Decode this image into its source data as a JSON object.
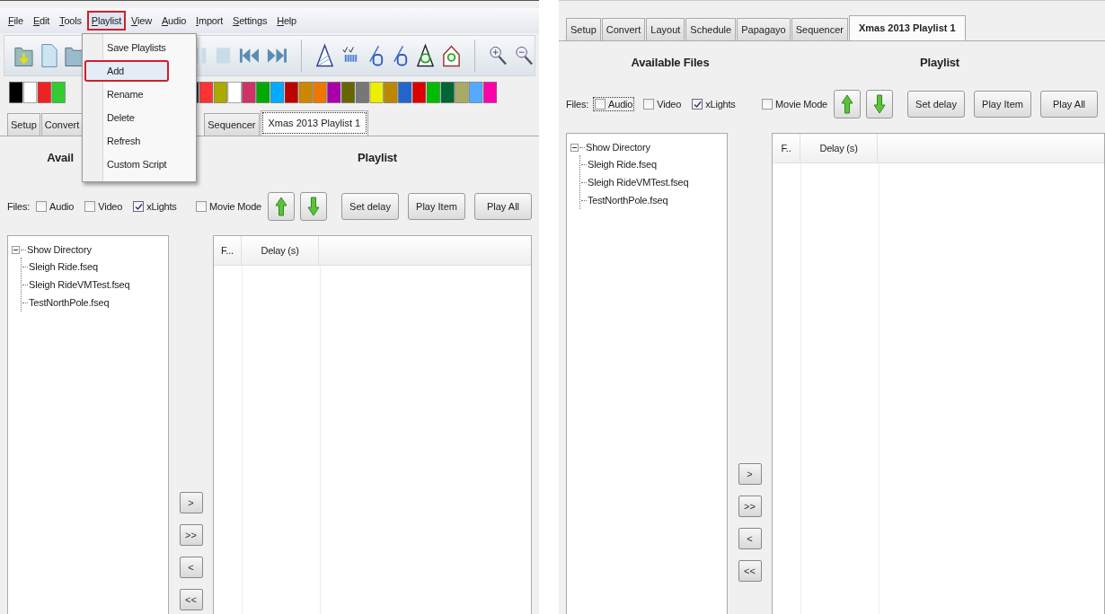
{
  "left": {
    "menu_bar": [
      {
        "label": "File",
        "open": false,
        "annotated": false
      },
      {
        "label": "Edit",
        "open": false,
        "annotated": false
      },
      {
        "label": "Tools",
        "open": false,
        "annotated": false
      },
      {
        "label": "Playlist",
        "open": true,
        "annotated": true
      },
      {
        "label": "View",
        "open": false,
        "annotated": false
      },
      {
        "label": "Audio",
        "open": false,
        "annotated": false
      },
      {
        "label": "Import",
        "open": false,
        "annotated": false
      },
      {
        "label": "Settings",
        "open": false,
        "annotated": false
      },
      {
        "label": "Help",
        "open": false,
        "annotated": false
      }
    ],
    "playlist_menu": [
      {
        "label": "Save Playlists",
        "highlighted": false,
        "annotated": false
      },
      {
        "label": "Add",
        "highlighted": true,
        "annotated": true
      },
      {
        "label": "Rename",
        "highlighted": false,
        "annotated": false
      },
      {
        "label": "Delete",
        "highlighted": false,
        "annotated": false
      },
      {
        "label": "Refresh",
        "highlighted": false,
        "annotated": false
      },
      {
        "label": "Custom Script",
        "highlighted": false,
        "annotated": false
      }
    ],
    "tabs": [
      {
        "label": "Setup",
        "selected": false,
        "focused": false
      },
      {
        "label": "Convert",
        "selected": false,
        "focused": false
      },
      {
        "label": "Sequencer",
        "selected": false,
        "focused": false
      },
      {
        "label": "Xmas 2013 Playlist 1",
        "selected": true,
        "focused": true
      }
    ],
    "available_files_title": "Avail",
    "playlist_title": "Playlist",
    "files_label": "Files:",
    "file_filters": [
      {
        "label": "Audio",
        "checked": false,
        "focused": false
      },
      {
        "label": "Video",
        "checked": false,
        "focused": false
      },
      {
        "label": "xLights",
        "checked": true,
        "focused": false
      }
    ],
    "movie_mode": {
      "label": "Movie Mode",
      "checked": false
    },
    "buttons": [
      "Set delay",
      "Play Item",
      "Play All"
    ],
    "tree": {
      "label": "Show Directory",
      "expanded": true,
      "children": [
        {
          "label": "Sleigh Ride.fseq"
        },
        {
          "label": "Sleigh RideVMTest.fseq"
        },
        {
          "label": "TestNorthPole.fseq"
        }
      ]
    },
    "table": {
      "columns": [
        "F...",
        "Delay (s)"
      ]
    },
    "transfer_buttons": [
      ">",
      ">>",
      "<",
      "<<"
    ]
  },
  "right": {
    "tabs": [
      {
        "label": "Setup",
        "selected": false,
        "focused": false
      },
      {
        "label": "Convert",
        "selected": false,
        "focused": false
      },
      {
        "label": "Layout",
        "selected": false,
        "focused": false
      },
      {
        "label": "Schedule",
        "selected": false,
        "focused": false
      },
      {
        "label": "Papagayo",
        "selected": false,
        "focused": false
      },
      {
        "label": "Sequencer",
        "selected": false,
        "focused": false
      },
      {
        "label": "Xmas 2013 Playlist 1",
        "selected": true,
        "focused": false
      }
    ],
    "available_files_title": "Available Files",
    "playlist_title": "Playlist",
    "files_label": "Files:",
    "file_filters": [
      {
        "label": "Audio",
        "checked": false,
        "focused": true
      },
      {
        "label": "Video",
        "checked": false,
        "focused": false
      },
      {
        "label": "xLights",
        "checked": true,
        "focused": false
      }
    ],
    "movie_mode": {
      "label": "Movie Mode",
      "checked": false
    },
    "buttons": [
      "Set delay",
      "Play Item",
      "Play All"
    ],
    "tree": {
      "label": "Show Directory",
      "expanded": true,
      "children": [
        {
          "label": "Sleigh Ride.fseq"
        },
        {
          "label": "Sleigh RideVMTest.fseq"
        },
        {
          "label": "TestNorthPole.fseq"
        }
      ]
    },
    "table": {
      "columns": [
        "F..",
        "Delay (s)"
      ]
    },
    "transfer_buttons": [
      ">",
      ">>",
      "<",
      "<<"
    ]
  }
}
